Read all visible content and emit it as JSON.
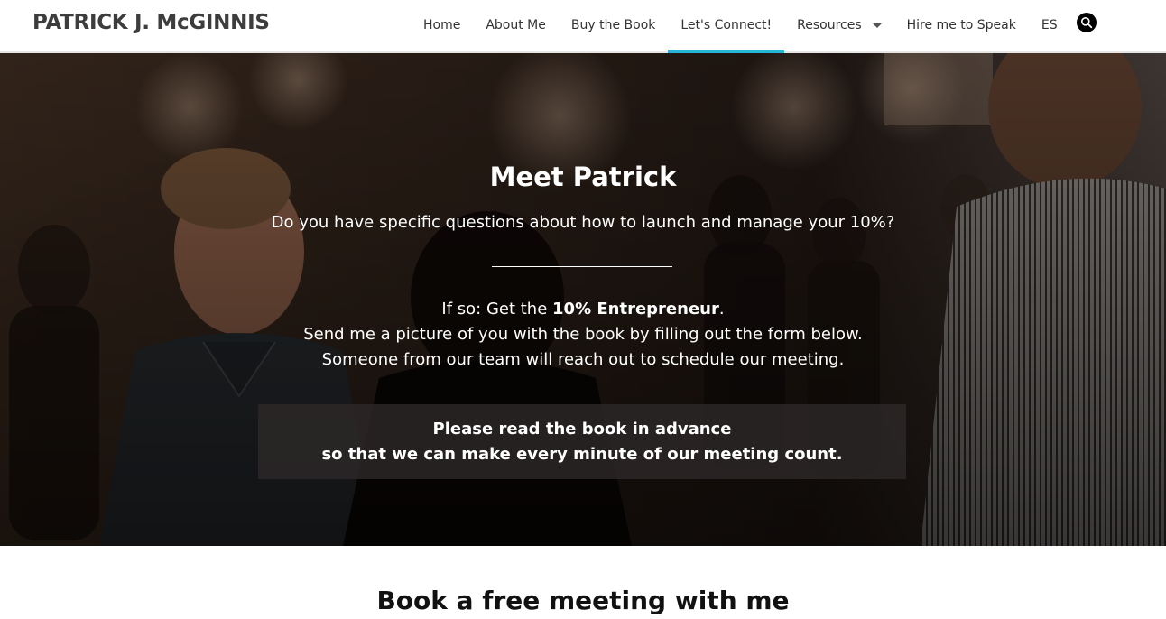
{
  "header": {
    "brand": "PATRICK J. McGINNIS",
    "nav": [
      {
        "label": "Home"
      },
      {
        "label": "About Me"
      },
      {
        "label": "Buy the Book"
      },
      {
        "label": "Let's Connect!"
      },
      {
        "label": "Resources"
      },
      {
        "label": "Hire me to Speak"
      },
      {
        "label": "ES"
      }
    ],
    "active_nav": "Let's Connect!",
    "accent_color": "#27b4d6",
    "search_icon": "search-icon"
  },
  "hero": {
    "title": "Meet Patrick",
    "question": "Do you have specific questions about how to launch and manage your 10%?",
    "line1_prefix": "If so: Get the ",
    "line1_bold": "10% Entrepreneur",
    "line1_suffix": ".",
    "line2": "Send me a picture of you with the book by filling out the form below.",
    "line3": "Someone from our team will reach out to schedule our meeting.",
    "notice_line1": "Please read the book in advance",
    "notice_line2": "so that we can make every minute of our meeting count."
  },
  "section": {
    "title": "Book a free meeting with me"
  }
}
